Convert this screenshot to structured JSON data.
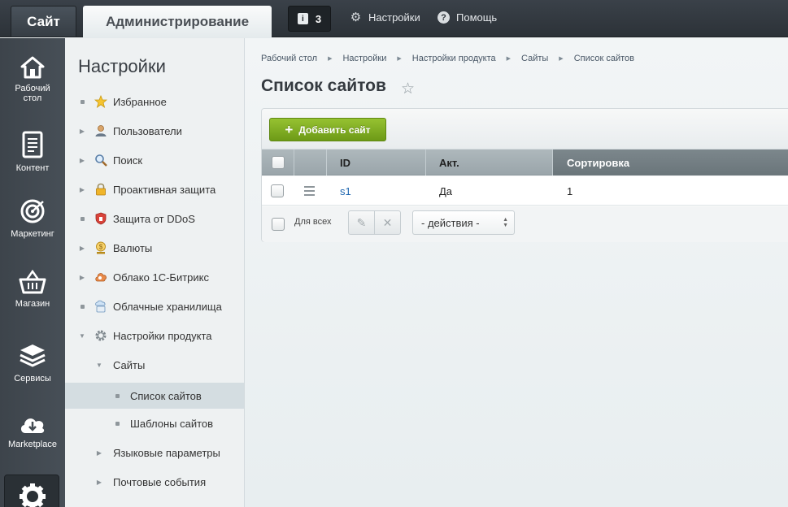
{
  "topbar": {
    "site_tab": "Сайт",
    "admin_tab": "Администрирование",
    "notifications_count": "3",
    "settings_link": "Настройки",
    "help_link": "Помощь"
  },
  "iconbar": {
    "items": [
      {
        "label_line1": "Рабочий",
        "label_line2": "стол",
        "icon": "home-icon"
      },
      {
        "label_line1": "Контент",
        "label_line2": "",
        "icon": "document-icon"
      },
      {
        "label_line1": "Маркетинг",
        "label_line2": "",
        "icon": "target-icon"
      },
      {
        "label_line1": "Магазин",
        "label_line2": "",
        "icon": "basket-icon"
      },
      {
        "label_line1": "Сервисы",
        "label_line2": "",
        "icon": "layers-icon"
      },
      {
        "label_line1": "Marketplace",
        "label_line2": "",
        "icon": "cloud-download-icon"
      }
    ],
    "active_icon": "gear-icon"
  },
  "sidebar": {
    "title": "Настройки",
    "items": [
      {
        "label": "Избранное",
        "icon": "star-icon",
        "marker": "dot"
      },
      {
        "label": "Пользователи",
        "icon": "user-icon",
        "marker": "arrow"
      },
      {
        "label": "Поиск",
        "icon": "search-icon",
        "marker": "arrow"
      },
      {
        "label": "Проактивная защита",
        "icon": "lock-icon",
        "marker": "arrow"
      },
      {
        "label": "Защита от DDoS",
        "icon": "shield-icon",
        "marker": "dot"
      },
      {
        "label": "Валюты",
        "icon": "currency-icon",
        "marker": "arrow"
      },
      {
        "label": "Облако 1С-Битрикс",
        "icon": "cloud-icon",
        "marker": "arrow"
      },
      {
        "label": "Облачные хранилища",
        "icon": "storage-icon",
        "marker": "dot"
      },
      {
        "label": "Настройки продукта",
        "icon": "gear-icon",
        "marker": "open"
      },
      {
        "label": "Сайты",
        "marker": "open"
      },
      {
        "label": "Список сайтов",
        "marker": "dot",
        "active": true
      },
      {
        "label": "Шаблоны сайтов",
        "marker": "dot"
      },
      {
        "label": "Языковые параметры",
        "marker": "arrow"
      },
      {
        "label": "Почтовые события",
        "marker": "arrow"
      }
    ]
  },
  "breadcrumbs": [
    "Рабочий стол",
    "Настройки",
    "Настройки продукта",
    "Сайты",
    "Список сайтов"
  ],
  "page": {
    "title": "Список сайтов"
  },
  "toolbar": {
    "add_label": "Добавить сайт"
  },
  "table": {
    "columns": [
      "ID",
      "Акт.",
      "Сортировка"
    ],
    "rows": [
      {
        "id": "s1",
        "active": "Да",
        "sort": "1"
      }
    ]
  },
  "footer": {
    "all_label": "Для всех",
    "actions_select": "- действия -"
  },
  "colors": {
    "accent_green": "#7cab1f",
    "topbar": "#2f353b",
    "link": "#2067b0"
  }
}
